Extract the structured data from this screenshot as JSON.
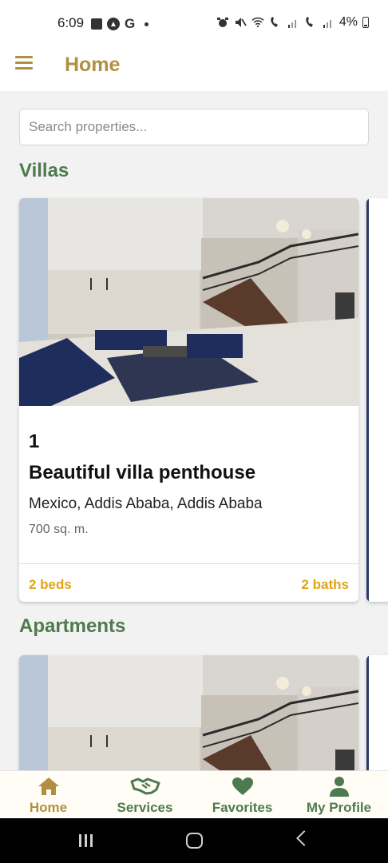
{
  "status_bar": {
    "time": "6:09",
    "left_icons": [
      "gallery-icon",
      "navigation-app-icon",
      "google-icon",
      "dot-icon"
    ],
    "right_icons": [
      "alarm-icon",
      "mute-icon",
      "wifi-icon",
      "volte-1-icon",
      "signal-1-icon",
      "volte-2-icon",
      "signal-2-icon"
    ],
    "battery": "4%"
  },
  "app_bar": {
    "title": "Home",
    "menu_icon": "hamburger-icon",
    "accent_color": "#b09040"
  },
  "search": {
    "placeholder": "Search properties..."
  },
  "sections": [
    {
      "title": "Villas",
      "cards": [
        {
          "image": "living-room-with-staircase-photo",
          "id": "1",
          "name": "Beautiful villa penthouse",
          "location": "Mexico, Addis Ababa, Addis Ababa",
          "area": "700 sq. m.",
          "beds": "2 beds",
          "baths": "2 baths"
        }
      ]
    },
    {
      "title": "Apartments",
      "cards": [
        {
          "image": "living-room-with-staircase-photo"
        }
      ]
    }
  ],
  "bottom_nav": {
    "items": [
      {
        "label": "Home",
        "icon": "home-icon",
        "active": true
      },
      {
        "label": "Services",
        "icon": "handshake-icon",
        "active": false
      },
      {
        "label": "Favorites",
        "icon": "heart-icon",
        "active": false
      },
      {
        "label": "My Profile",
        "icon": "person-icon",
        "active": false
      }
    ],
    "active_color": "#b09040",
    "inactive_color": "#4e7a4e"
  },
  "system_nav": {
    "buttons": [
      "recents-icon",
      "home-circle-icon",
      "back-icon"
    ]
  }
}
